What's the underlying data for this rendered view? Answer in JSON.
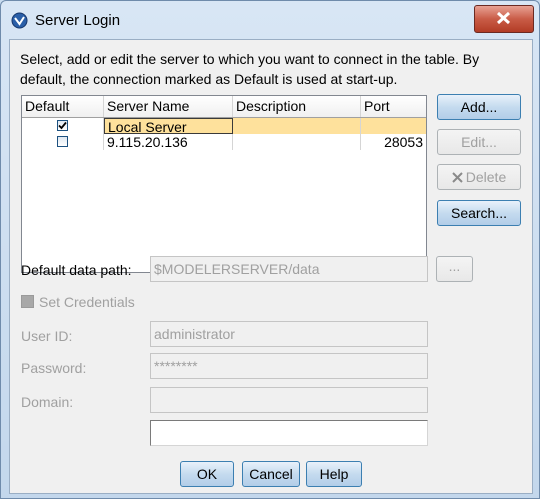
{
  "window": {
    "title": "Server Login"
  },
  "instructions": "Select, add or edit the server to which you want to connect in the table. By default, the connection marked as Default is used at start-up.",
  "table": {
    "columns": [
      "Default",
      "Server Name",
      "Description",
      "Port"
    ],
    "rows": [
      {
        "default": true,
        "server_name": "Local Server",
        "description": "",
        "port": ""
      },
      {
        "default": false,
        "server_name": "9.115.20.136",
        "description": "",
        "port": "28053"
      }
    ]
  },
  "side_buttons": {
    "add": "Add...",
    "edit": "Edit...",
    "delete": "Delete",
    "search": "Search..."
  },
  "data_path": {
    "label": "Default data path:",
    "value": "$MODELERSERVER/data",
    "browse": "..."
  },
  "credentials": {
    "set_label": "Set Credentials",
    "user_id_label": "User ID:",
    "user_id_value": "administrator",
    "password_label": "Password:",
    "password_value": "********",
    "domain_label": "Domain:",
    "domain_value": ""
  },
  "footer": {
    "ok": "OK",
    "cancel": "Cancel",
    "help": "Help"
  }
}
